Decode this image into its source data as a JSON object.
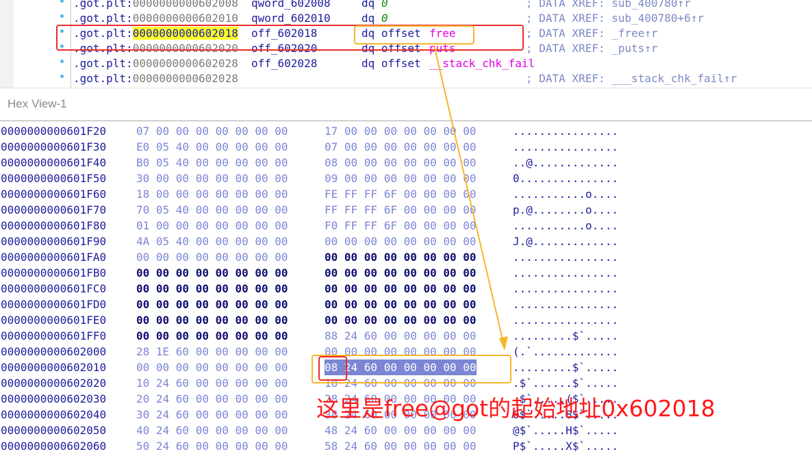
{
  "disasm": {
    "lines": [
      {
        "seg": ".got.plt:",
        "addr": "0000000000602008",
        "name": "qword_602008",
        "mn": "dq",
        "arg": [
          {
            "t": "zero",
            "v": "0"
          }
        ],
        "cmt": "; DATA XREF: sub_400780↑r",
        "highlight": false
      },
      {
        "seg": ".got.plt:",
        "addr": "0000000000602010",
        "name": "qword_602010",
        "mn": "dq",
        "arg": [
          {
            "t": "zero",
            "v": "0"
          }
        ],
        "cmt": "; DATA XREF: sub_400780+6↑r",
        "highlight": false
      },
      {
        "seg": ".got.plt:",
        "addr": "0000000000602018",
        "name": "off_602018",
        "mn": "dq offset",
        "arg": [
          {
            "t": "sym",
            "v": "free"
          }
        ],
        "cmt": "; DATA XREF: _free↑r",
        "highlight": true
      },
      {
        "seg": ".got.plt:",
        "addr": "0000000000602020",
        "name": "off_602020",
        "mn": "dq offset",
        "arg": [
          {
            "t": "sym",
            "v": "puts"
          }
        ],
        "cmt": "; DATA XREF: _puts↑r",
        "highlight": false
      },
      {
        "seg": ".got.plt:",
        "addr": "0000000000602028",
        "name": "off_602028",
        "mn": "dq offset",
        "arg": [
          {
            "t": "sym",
            "v": "__stack_chk_fail"
          }
        ],
        "cmt": "",
        "highlight": false
      },
      {
        "seg": ".got.plt:",
        "addr": "0000000000602028",
        "name": "",
        "mn": "",
        "arg": [],
        "cmt": "; DATA XREF: ___stack_chk_fail↑r",
        "highlight": false
      }
    ]
  },
  "hexview": {
    "title": "Hex View-1",
    "rows": [
      {
        "addr": "0000000000601F20",
        "b1": "07 00 00 00 00 00 00 00",
        "b2": "17 00 00 00 00 00 00 00",
        "ascii": "................",
        "dark1": false,
        "dark2": false
      },
      {
        "addr": "0000000000601F30",
        "b1": "E0 05 40 00 00 00 00 00",
        "b2": "07 00 00 00 00 00 00 00",
        "ascii": "................",
        "dark1": false,
        "dark2": false
      },
      {
        "addr": "0000000000601F40",
        "b1": "B0 05 40 00 00 00 00 00",
        "b2": "08 00 00 00 00 00 00 00",
        "ascii": "..@.............",
        "dark1": false,
        "dark2": false
      },
      {
        "addr": "0000000000601F50",
        "b1": "30 00 00 00 00 00 00 00",
        "b2": "09 00 00 00 00 00 00 00",
        "ascii": "0...............",
        "dark1": false,
        "dark2": false
      },
      {
        "addr": "0000000000601F60",
        "b1": "18 00 00 00 00 00 00 00",
        "b2": "FE FF FF 6F 00 00 00 00",
        "ascii": "...........o....",
        "dark1": false,
        "dark2": false
      },
      {
        "addr": "0000000000601F70",
        "b1": "70 05 40 00 00 00 00 00",
        "b2": "FF FF FF 6F 00 00 00 00",
        "ascii": "p.@........o....",
        "dark1": false,
        "dark2": false
      },
      {
        "addr": "0000000000601F80",
        "b1": "01 00 00 00 00 00 00 00",
        "b2": "F0 FF FF 6F 00 00 00 00",
        "ascii": "...........o....",
        "dark1": false,
        "dark2": false
      },
      {
        "addr": "0000000000601F90",
        "b1": "4A 05 40 00 00 00 00 00",
        "b2": "00 00 00 00 00 00 00 00",
        "ascii": "J.@.............",
        "dark1": false,
        "dark2": false
      },
      {
        "addr": "0000000000601FA0",
        "b1": "00 00 00 00 00 00 00 00",
        "b2": "00 00 00 00 00 00 00 00",
        "ascii": "................",
        "dark1": false,
        "dark2": true
      },
      {
        "addr": "0000000000601FB0",
        "b1": "00 00 00 00 00 00 00 00",
        "b2": "00 00 00 00 00 00 00 00",
        "ascii": "................",
        "dark1": true,
        "dark2": true
      },
      {
        "addr": "0000000000601FC0",
        "b1": "00 00 00 00 00 00 00 00",
        "b2": "00 00 00 00 00 00 00 00",
        "ascii": "................",
        "dark1": true,
        "dark2": true
      },
      {
        "addr": "0000000000601FD0",
        "b1": "00 00 00 00 00 00 00 00",
        "b2": "00 00 00 00 00 00 00 00",
        "ascii": "................",
        "dark1": true,
        "dark2": true
      },
      {
        "addr": "0000000000601FE0",
        "b1": "00 00 00 00 00 00 00 00",
        "b2": "00 00 00 00 00 00 00 00",
        "ascii": "................",
        "dark1": true,
        "dark2": true
      },
      {
        "addr": "0000000000601FF0",
        "b1": "00 00 00 00 00 00 00 00",
        "b2": "88 24 60 00 00 00 00 00",
        "ascii": ".........$`.....",
        "dark1": true,
        "dark2": false
      },
      {
        "addr": "0000000000602000",
        "b1": "28 1E 60 00 00 00 00 00",
        "b2": "00 00 00 00 00 00 00 00",
        "ascii": "(.`.............",
        "dark1": false,
        "dark2": false
      },
      {
        "addr": "0000000000602010",
        "b1": "00 00 00 00 00 00 00 00",
        "b2": "08 24 60 00 00 00 00 00",
        "ascii": ".........$`.....",
        "dark1": false,
        "dark2": false,
        "selected2": true
      },
      {
        "addr": "0000000000602020",
        "b1": "10 24 60 00 00 00 00 00",
        "b2": "18 24 60 00 00 00 00 00",
        "ascii": ".$`......$`.....",
        "dark1": false,
        "dark2": false
      },
      {
        "addr": "0000000000602030",
        "b1": "20 24 60 00 00 00 00 00",
        "b2": "28 24 60 00 00 00 00 00",
        "ascii": " $`.....($`.....",
        "dark1": false,
        "dark2": false
      },
      {
        "addr": "0000000000602040",
        "b1": "30 24 60 00 00 00 00 00",
        "b2": "38 24 60 00 00 00 00 00",
        "ascii": "0$`.....8$`.....",
        "dark1": false,
        "dark2": false
      },
      {
        "addr": "0000000000602050",
        "b1": "40 24 60 00 00 00 00 00",
        "b2": "48 24 60 00 00 00 00 00",
        "ascii": "@$`.....H$`.....",
        "dark1": false,
        "dark2": false
      },
      {
        "addr": "0000000000602060",
        "b1": "50 24 60 00 00 00 00 00",
        "b2": "58 24 60 00 00 00 00 00",
        "ascii": "P$`.....X$`.....",
        "dark1": false,
        "dark2": false
      }
    ]
  },
  "annotation": {
    "text": "这里是free@got的起始地址0x602018",
    "colors": {
      "red": "#ea2b2b",
      "orange": "#f7b52a",
      "text": "#ff1a1a"
    }
  }
}
